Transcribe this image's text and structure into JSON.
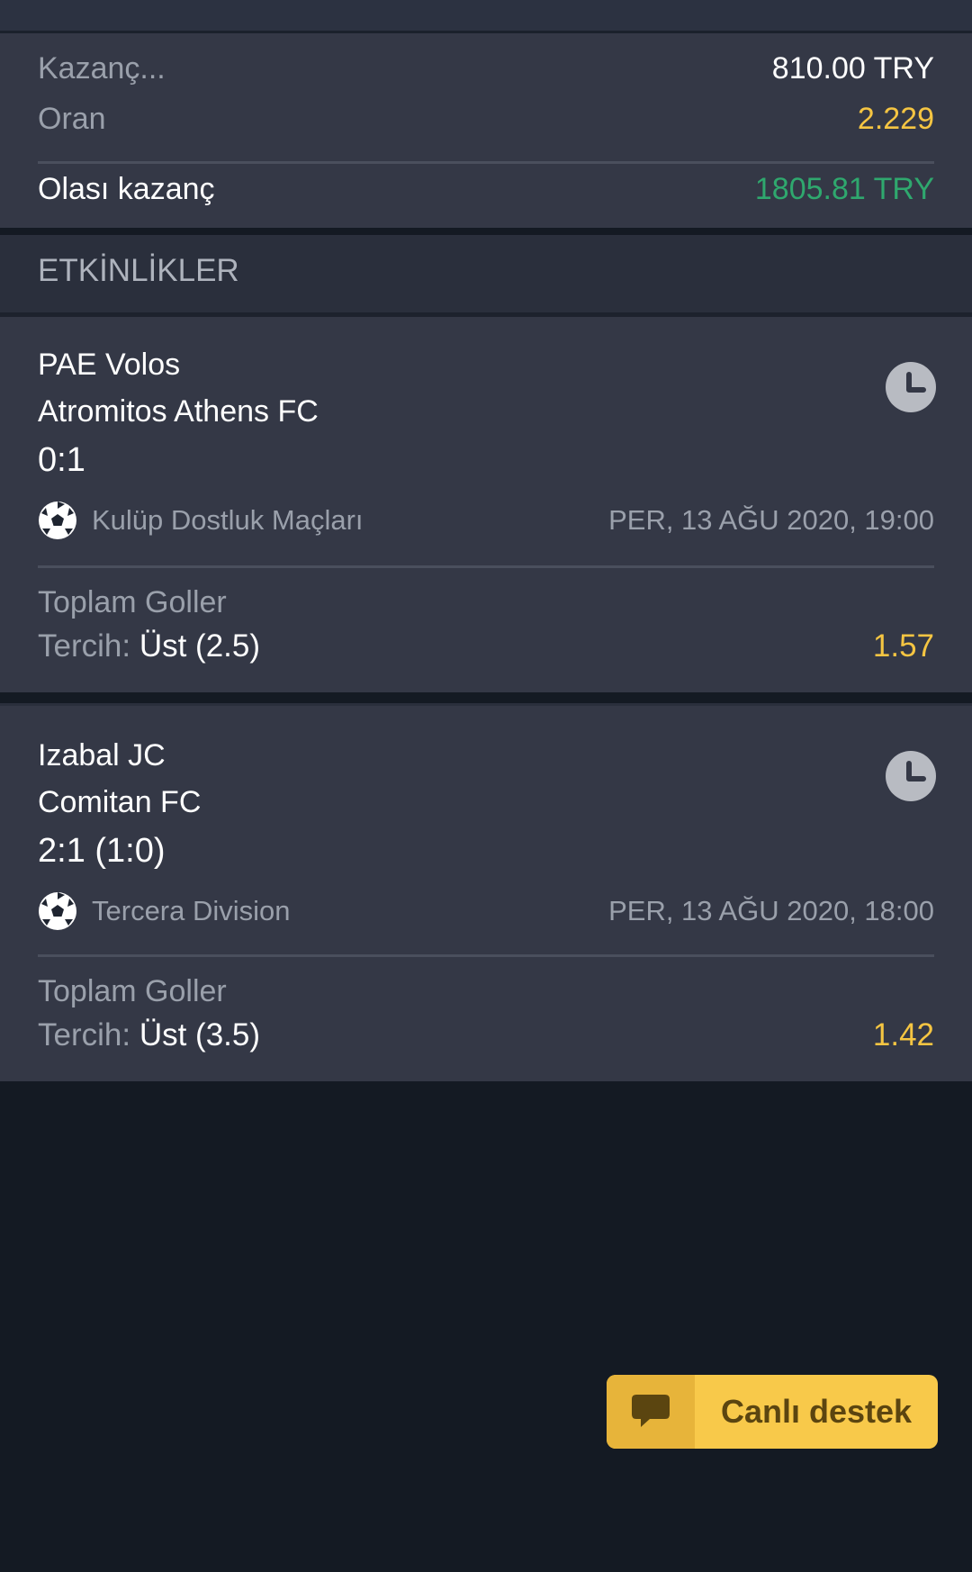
{
  "summary": {
    "stake_label": "Kazanç...",
    "stake_value": "810.00 TRY",
    "odds_label": "Oran",
    "odds_value": "2.229",
    "potential_label": "Olası kazanç",
    "potential_value": "1805.81 TRY"
  },
  "events_header": "ETKİNLİKLER",
  "events": [
    {
      "team1": "PAE Volos",
      "team2": "Atromitos Athens FC",
      "score": "0:1",
      "league": "Kulüp Dostluk Maçları",
      "datetime": "PER, 13 AĞU 2020, 19:00",
      "market": "Toplam Goller",
      "pick_label": "Tercih:",
      "pick_value": "Üst (2.5)",
      "odds": "1.57"
    },
    {
      "team1": "Izabal JC",
      "team2": "Comitan FC",
      "score": "2:1 (1:0)",
      "league": "Tercera Division",
      "datetime": "PER, 13 AĞU 2020, 18:00",
      "market": "Toplam Goller",
      "pick_label": "Tercih:",
      "pick_value": "Üst (3.5)",
      "odds": "1.42"
    }
  ],
  "support_button": {
    "label": "Canlı destek",
    "icon": "chat-bubble-icon"
  },
  "icons": {
    "status": "clock-icon",
    "sport": "soccer-ball-icon"
  },
  "colors": {
    "odds": "#f5c542",
    "win": "#2fa86e",
    "button": "#f8c94a"
  }
}
